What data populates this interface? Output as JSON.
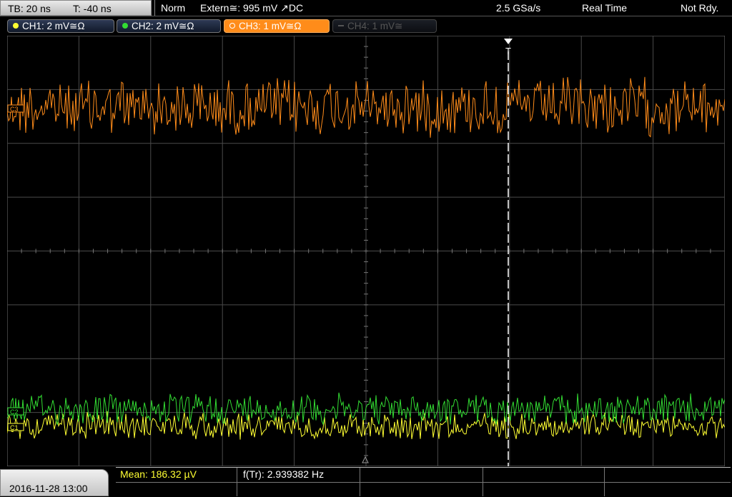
{
  "header": {
    "timebase": "TB: 20 ns",
    "trigger_time": "T: -40 ns",
    "mode": "Norm",
    "trigger_source": "Extern≅: 995 mV ↗DC",
    "sample_rate": "2.5 GSa/s",
    "acq_mode": "Real Time",
    "status": "Not Rdy."
  },
  "channels": [
    {
      "label": "CH1: 2 mV≅Ω",
      "color": "#ffff33",
      "state": "on"
    },
    {
      "label": "CH2: 2 mV≅Ω",
      "color": "#33dd33",
      "state": "on"
    },
    {
      "label": "CH3: 1 mV≅Ω",
      "color": "#ff8c1a",
      "state": "selected"
    },
    {
      "label": "CH4: 1 mV≅",
      "color": "#666666",
      "state": "off"
    }
  ],
  "channel_markers": {
    "ch3": "C3",
    "ch2": "C2",
    "ch1": "C1"
  },
  "trigger_marker": "T",
  "measurements": {
    "mean": "Mean: 186.32 µV",
    "freq": "f(Tr): 2.939382 Hz"
  },
  "datetime": "2016-11-28 13:00",
  "colors": {
    "ch1": "#ffff33",
    "ch2": "#33dd33",
    "ch3": "#ff8c1a",
    "grid": "#4a4a4a",
    "background": "#000000"
  }
}
